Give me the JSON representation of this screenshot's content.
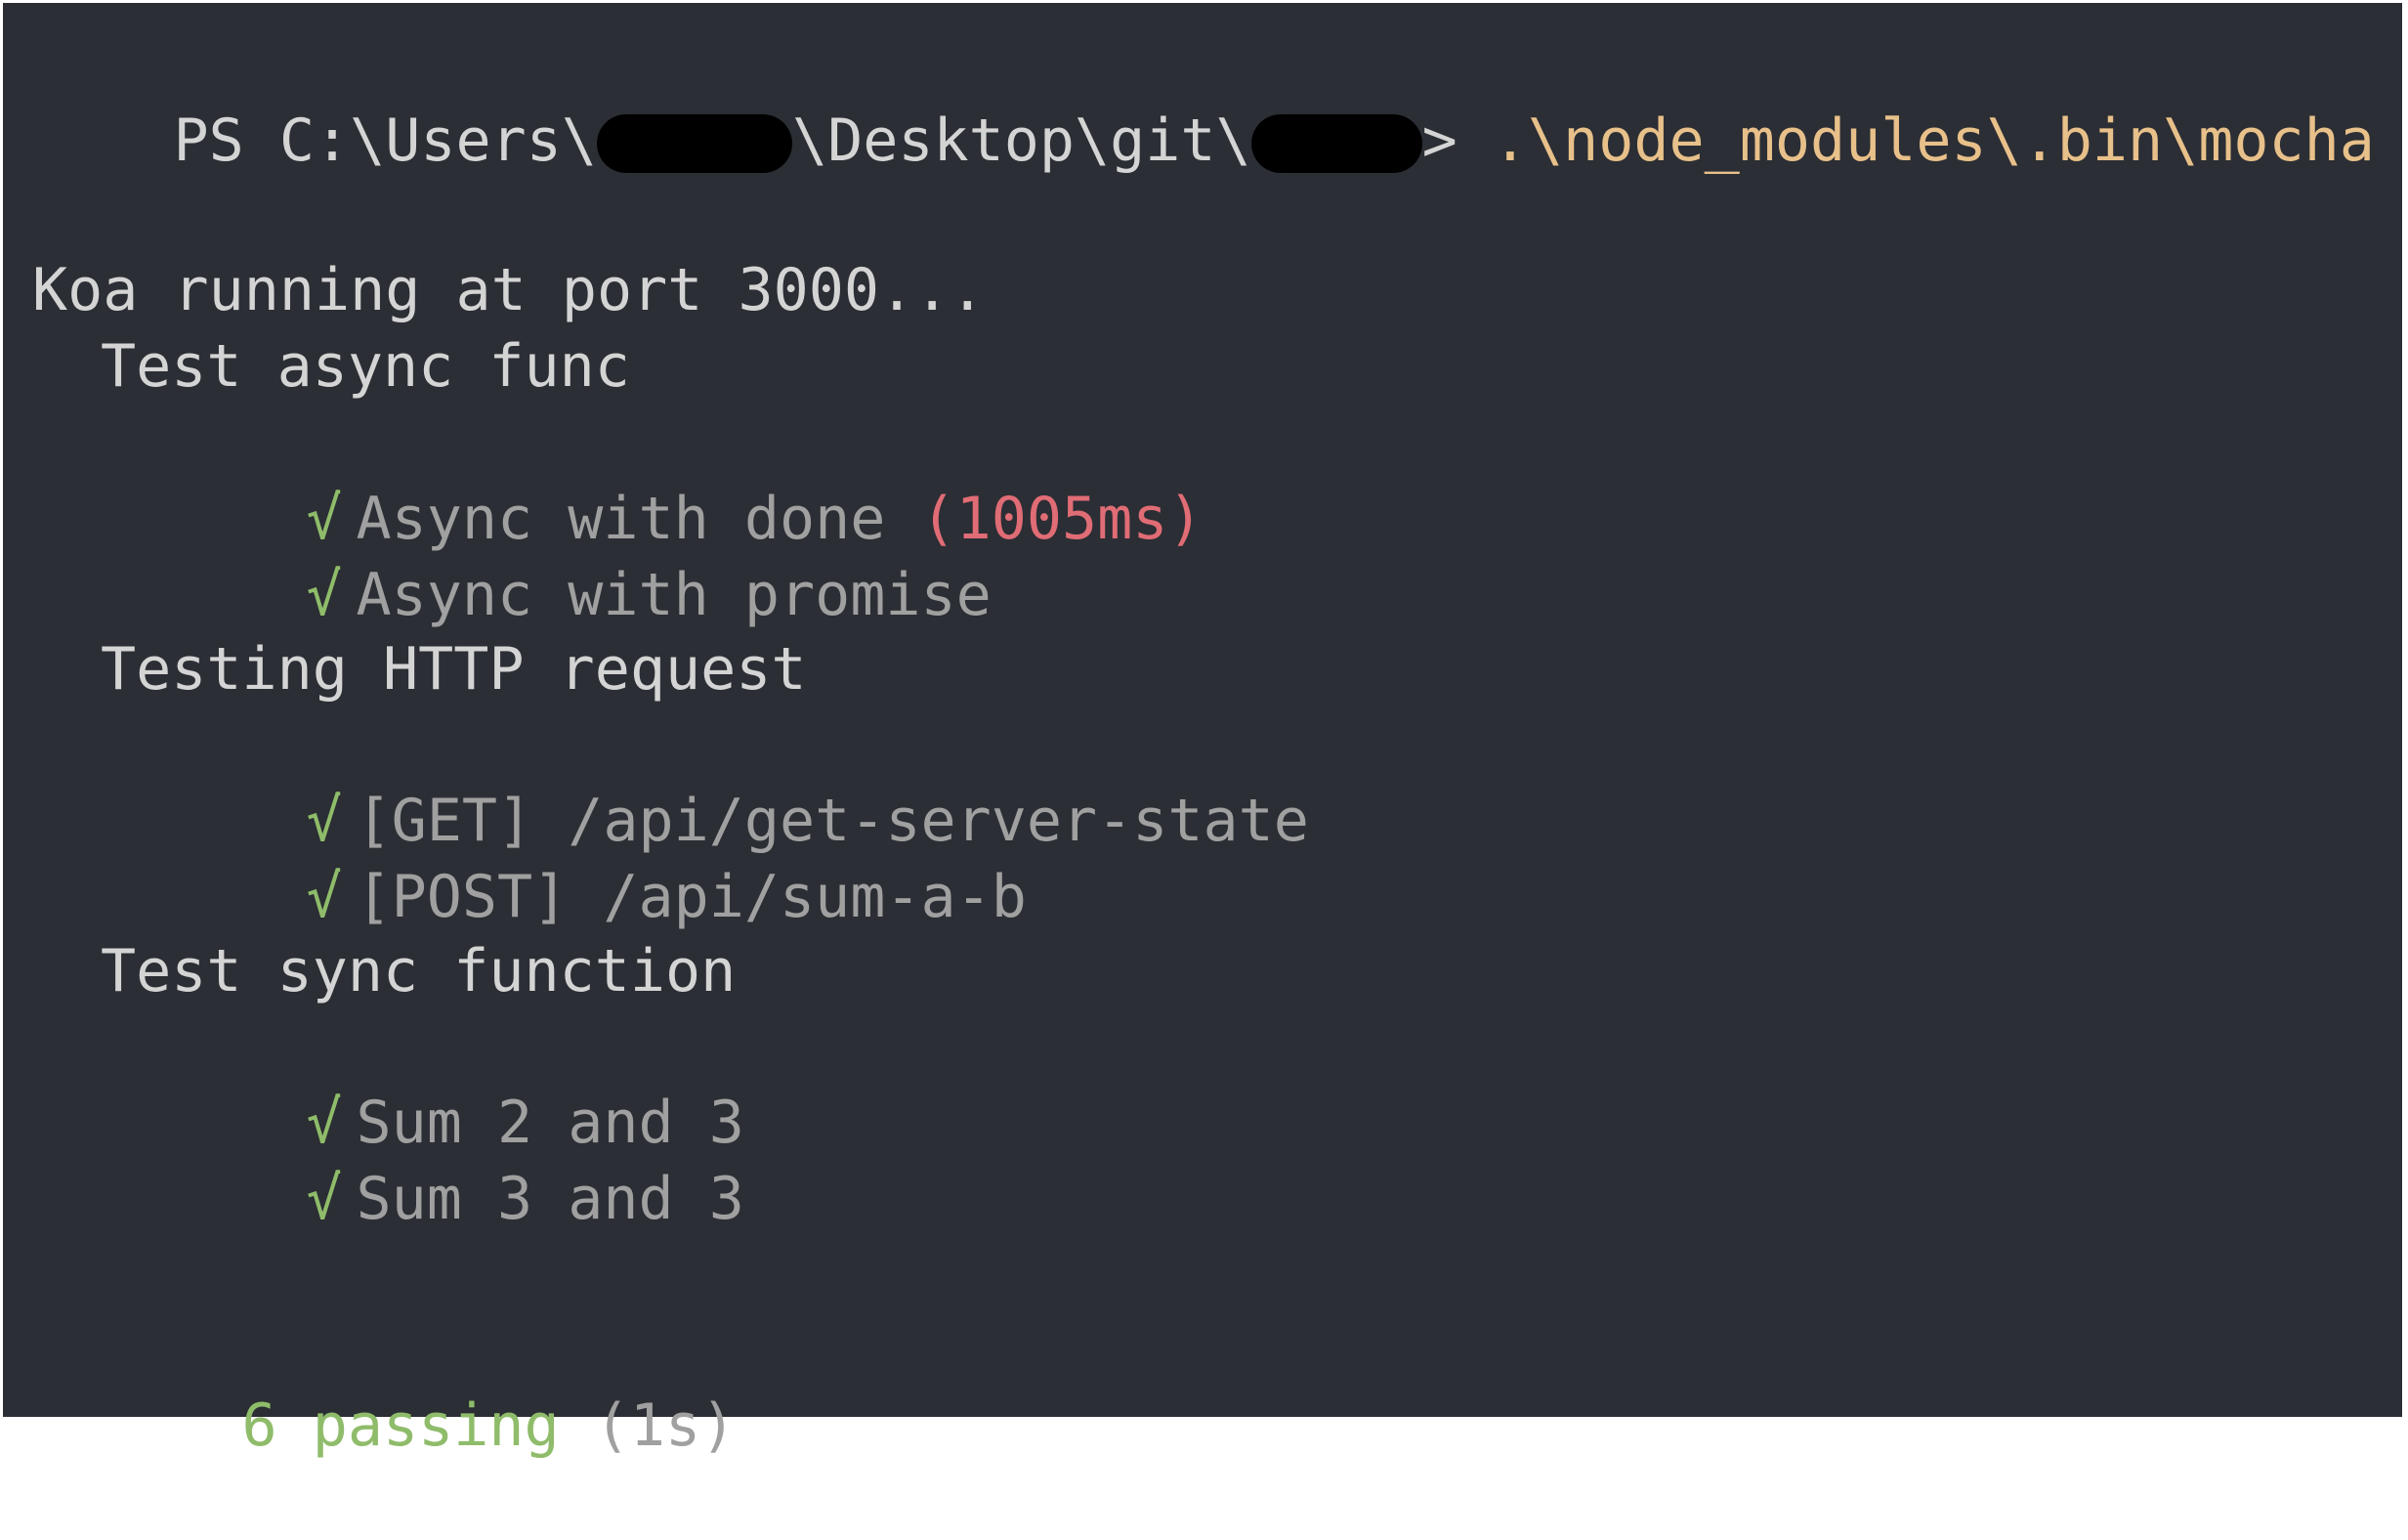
{
  "prompt": {
    "ps": "PS C:\\Users\\",
    "middle": "\\Desktop\\git\\",
    "arrow": ">",
    "command": " .\\node_modules\\.bin\\mocha"
  },
  "server_msg": "Koa running at port 3000...",
  "suites": [
    {
      "title": "Test async func",
      "tests": [
        {
          "check": "√",
          "name": "Async with done",
          "duration": "(1005ms)"
        },
        {
          "check": "√",
          "name": "Async with promise"
        }
      ]
    },
    {
      "title": "Testing HTTP request",
      "tests": [
        {
          "check": "√",
          "name": "[GET] /api/get-server-state"
        },
        {
          "check": "√",
          "name": "[POST] /api/sum-a-b"
        }
      ]
    },
    {
      "title": "Test sync function",
      "tests": [
        {
          "check": "√",
          "name": "Sum 2 and 3"
        },
        {
          "check": "√",
          "name": "Sum 3 and 3"
        }
      ]
    }
  ],
  "summary": {
    "passing": "6 passing",
    "time": "(1s)"
  },
  "colors": {
    "background": "#2b2e34",
    "pass": "#8fbc6a",
    "slow": "#e06c75",
    "command": "#e8c08a"
  }
}
